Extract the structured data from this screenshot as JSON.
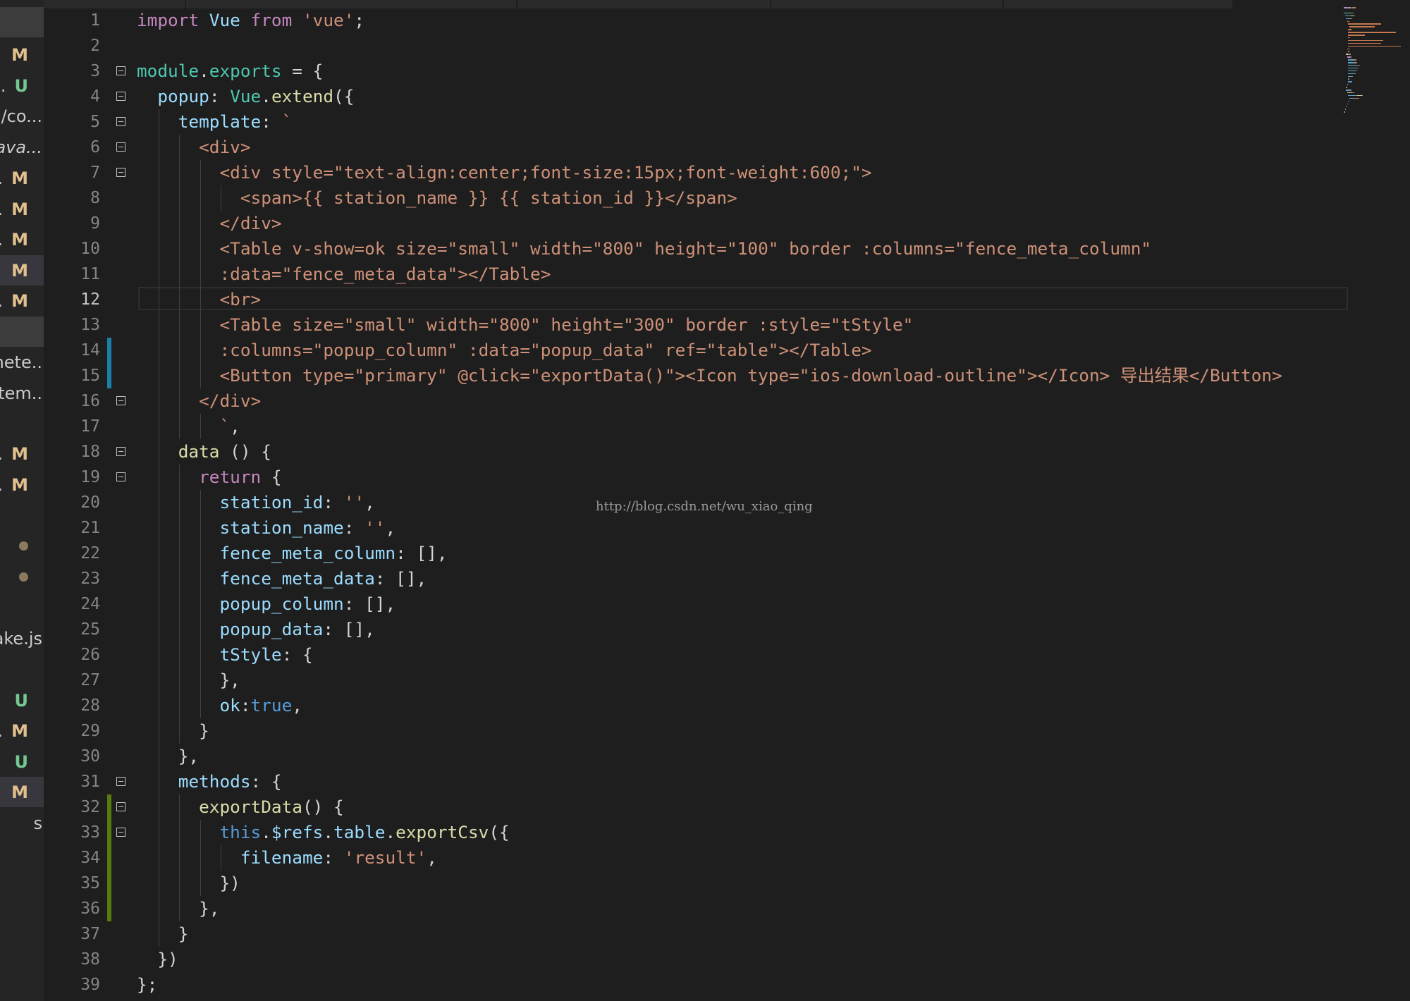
{
  "sidebar": {
    "items": [
      {
        "label": "",
        "badge": "",
        "variant": "sel-light"
      },
      {
        "label": "",
        "badge": "M"
      },
      {
        "label": "..",
        "badge": "U"
      },
      {
        "label": "/co...",
        "badge": ""
      },
      {
        "label": "java...",
        "badge": ""
      },
      {
        "label": ".",
        "badge": "M"
      },
      {
        "label": ".",
        "badge": "M"
      },
      {
        "label": ".",
        "badge": "M"
      },
      {
        "label": "",
        "badge": "M",
        "variant": "selected"
      },
      {
        "label": ".",
        "badge": "M"
      },
      {
        "label": "",
        "badge": "",
        "variant": "sel-light"
      },
      {
        "label": "nete..",
        "badge": ""
      },
      {
        "label": "tem..",
        "badge": ""
      },
      {
        "label": "",
        "badge": ""
      },
      {
        "label": ".",
        "badge": "M"
      },
      {
        "label": ".",
        "badge": "M"
      },
      {
        "label": "",
        "badge": ""
      },
      {
        "label": "",
        "badge": "dot"
      },
      {
        "label": "",
        "badge": "dot"
      },
      {
        "label": "",
        "badge": ""
      },
      {
        "label": "ake.js",
        "badge": ""
      },
      {
        "label": "",
        "badge": ""
      },
      {
        "label": "",
        "badge": "U"
      },
      {
        "label": ".",
        "badge": "M"
      },
      {
        "label": "",
        "badge": "U"
      },
      {
        "label": "",
        "badge": "M",
        "variant": "selected"
      },
      {
        "label": "s",
        "badge": ""
      }
    ]
  },
  "editor": {
    "current_line": 12,
    "lines": [
      {
        "num": "1",
        "tokens": [
          [
            "import",
            "kw"
          ],
          [
            " ",
            "pun"
          ],
          [
            "Vue",
            "var"
          ],
          [
            " ",
            "pun"
          ],
          [
            "from",
            "kw"
          ],
          [
            " ",
            "pun"
          ],
          [
            "'vue'",
            "str"
          ],
          [
            ";",
            "pun"
          ]
        ]
      },
      {
        "num": "2",
        "tokens": []
      },
      {
        "num": "3",
        "fold": true,
        "tokens": [
          [
            "module",
            "cls"
          ],
          [
            ".",
            "pun"
          ],
          [
            "exports",
            "cls"
          ],
          [
            " = {",
            "pun"
          ]
        ]
      },
      {
        "num": "4",
        "fold": true,
        "tokens": [
          [
            "  ",
            "pun"
          ],
          [
            "popup",
            "var"
          ],
          [
            ": ",
            "pun"
          ],
          [
            "Vue",
            "cls"
          ],
          [
            ".",
            "pun"
          ],
          [
            "extend",
            "fn"
          ],
          [
            "({",
            "pun"
          ]
        ]
      },
      {
        "num": "5",
        "fold": true,
        "tokens": [
          [
            "    ",
            "pun"
          ],
          [
            "template",
            "var"
          ],
          [
            ": ",
            "pun"
          ],
          [
            "`",
            "str"
          ]
        ]
      },
      {
        "num": "6",
        "fold": true,
        "tokens": [
          [
            "      ",
            "pun"
          ],
          [
            "<div>",
            "str"
          ]
        ]
      },
      {
        "num": "7",
        "fold": true,
        "tokens": [
          [
            "        ",
            "pun"
          ],
          [
            "<div style=\"text-align:center;font-size:15px;font-weight:600;\">",
            "str"
          ]
        ]
      },
      {
        "num": "8",
        "tokens": [
          [
            "          ",
            "pun"
          ],
          [
            "<span>{{ station_name }} {{ station_id }}</span>",
            "str"
          ]
        ]
      },
      {
        "num": "9",
        "tokens": [
          [
            "        ",
            "pun"
          ],
          [
            "</div>",
            "str"
          ]
        ]
      },
      {
        "num": "10",
        "tokens": [
          [
            "        ",
            "pun"
          ],
          [
            "<Table v-show=ok size=\"small\" width=\"800\" height=\"100\" border :columns=\"fence_meta_column\"",
            "str"
          ]
        ]
      },
      {
        "num": "11",
        "tokens": [
          [
            "        ",
            "pun"
          ],
          [
            ":data=\"fence_meta_data\"></Table>",
            "str"
          ]
        ]
      },
      {
        "num": "12",
        "tokens": [
          [
            "        ",
            "pun"
          ],
          [
            "<br>",
            "str"
          ]
        ]
      },
      {
        "num": "13",
        "tokens": [
          [
            "        ",
            "pun"
          ],
          [
            "<Table size=\"small\" width=\"800\" height=\"300\" border :style=\"tStyle\"",
            "str"
          ]
        ]
      },
      {
        "num": "14",
        "git": "modified",
        "tokens": [
          [
            "        ",
            "pun"
          ],
          [
            ":columns=\"popup_column\" :data=\"popup_data\" ref=\"table\"></Table>",
            "str"
          ]
        ]
      },
      {
        "num": "15",
        "git": "modified",
        "tokens": [
          [
            "        ",
            "pun"
          ],
          [
            "<Button type=\"primary\" @click=\"exportData()\"><Icon type=\"ios-download-outline\"></Icon> 导出结果</Button>",
            "str"
          ]
        ]
      },
      {
        "num": "16",
        "fold": true,
        "tokens": [
          [
            "      ",
            "pun"
          ],
          [
            "</div>",
            "str"
          ]
        ]
      },
      {
        "num": "17",
        "tokens": [
          [
            "        ",
            "pun"
          ],
          [
            "`",
            "str"
          ],
          [
            ",",
            "pun"
          ]
        ]
      },
      {
        "num": "18",
        "fold": true,
        "tokens": [
          [
            "    ",
            "pun"
          ],
          [
            "data",
            "fn"
          ],
          [
            " () {",
            "pun"
          ]
        ]
      },
      {
        "num": "19",
        "fold": true,
        "tokens": [
          [
            "      ",
            "pun"
          ],
          [
            "return",
            "kw"
          ],
          [
            " {",
            "pun"
          ]
        ]
      },
      {
        "num": "20",
        "tokens": [
          [
            "        ",
            "pun"
          ],
          [
            "station_id",
            "var"
          ],
          [
            ": ",
            "pun"
          ],
          [
            "''",
            "str"
          ],
          [
            ",",
            "pun"
          ]
        ]
      },
      {
        "num": "21",
        "tokens": [
          [
            "        ",
            "pun"
          ],
          [
            "station_name",
            "var"
          ],
          [
            ": ",
            "pun"
          ],
          [
            "''",
            "str"
          ],
          [
            ",",
            "pun"
          ]
        ]
      },
      {
        "num": "22",
        "tokens": [
          [
            "        ",
            "pun"
          ],
          [
            "fence_meta_column",
            "var"
          ],
          [
            ": [],",
            "pun"
          ]
        ]
      },
      {
        "num": "23",
        "tokens": [
          [
            "        ",
            "pun"
          ],
          [
            "fence_meta_data",
            "var"
          ],
          [
            ": [],",
            "pun"
          ]
        ]
      },
      {
        "num": "24",
        "tokens": [
          [
            "        ",
            "pun"
          ],
          [
            "popup_column",
            "var"
          ],
          [
            ": [],",
            "pun"
          ]
        ]
      },
      {
        "num": "25",
        "tokens": [
          [
            "        ",
            "pun"
          ],
          [
            "popup_data",
            "var"
          ],
          [
            ": [],",
            "pun"
          ]
        ]
      },
      {
        "num": "26",
        "tokens": [
          [
            "        ",
            "pun"
          ],
          [
            "tStyle",
            "var"
          ],
          [
            ": {",
            "pun"
          ]
        ]
      },
      {
        "num": "27",
        "tokens": [
          [
            "        ",
            "pun"
          ],
          [
            "},",
            "pun"
          ]
        ]
      },
      {
        "num": "28",
        "tokens": [
          [
            "        ",
            "pun"
          ],
          [
            "ok",
            "var"
          ],
          [
            ":",
            "pun"
          ],
          [
            "true",
            "kw2"
          ],
          [
            ",",
            "pun"
          ]
        ]
      },
      {
        "num": "29",
        "tokens": [
          [
            "      ",
            "pun"
          ],
          [
            "}",
            "pun"
          ]
        ]
      },
      {
        "num": "30",
        "tokens": [
          [
            "    ",
            "pun"
          ],
          [
            "},",
            "pun"
          ]
        ]
      },
      {
        "num": "31",
        "fold": true,
        "tokens": [
          [
            "    ",
            "pun"
          ],
          [
            "methods",
            "var"
          ],
          [
            ": {",
            "pun"
          ]
        ]
      },
      {
        "num": "32",
        "fold": true,
        "git": "added",
        "tokens": [
          [
            "      ",
            "pun"
          ],
          [
            "exportData",
            "fn"
          ],
          [
            "() {",
            "pun"
          ]
        ]
      },
      {
        "num": "33",
        "fold": true,
        "git": "added",
        "tokens": [
          [
            "        ",
            "pun"
          ],
          [
            "this",
            "kw2"
          ],
          [
            ".",
            "pun"
          ],
          [
            "$refs",
            "var"
          ],
          [
            ".",
            "pun"
          ],
          [
            "table",
            "var"
          ],
          [
            ".",
            "pun"
          ],
          [
            "exportCsv",
            "fn"
          ],
          [
            "({",
            "pun"
          ]
        ]
      },
      {
        "num": "34",
        "git": "added",
        "tokens": [
          [
            "          ",
            "pun"
          ],
          [
            "filename",
            "var"
          ],
          [
            ": ",
            "pun"
          ],
          [
            "'result'",
            "str"
          ],
          [
            ",",
            "pun"
          ]
        ]
      },
      {
        "num": "35",
        "git": "added",
        "tokens": [
          [
            "        ",
            "pun"
          ],
          [
            "})",
            "pun"
          ]
        ]
      },
      {
        "num": "36",
        "git": "added",
        "tokens": [
          [
            "      ",
            "pun"
          ],
          [
            "},",
            "pun"
          ]
        ]
      },
      {
        "num": "37",
        "tokens": [
          [
            "    ",
            "pun"
          ],
          [
            "}",
            "pun"
          ]
        ]
      },
      {
        "num": "38",
        "tokens": [
          [
            "  ",
            "pun"
          ],
          [
            "})",
            "pun"
          ]
        ]
      },
      {
        "num": "39",
        "tokens": [
          [
            "};",
            "pun"
          ]
        ]
      }
    ]
  },
  "watermark": "http://blog.csdn.net/wu_xiao_qing",
  "colors": {
    "background": "#1e1e1e",
    "sidebar": "#252526",
    "git_modified": "#1b81a8",
    "git_added": "#587c0c",
    "badge_modified": "#e2c08d",
    "badge_untracked": "#73c991"
  }
}
